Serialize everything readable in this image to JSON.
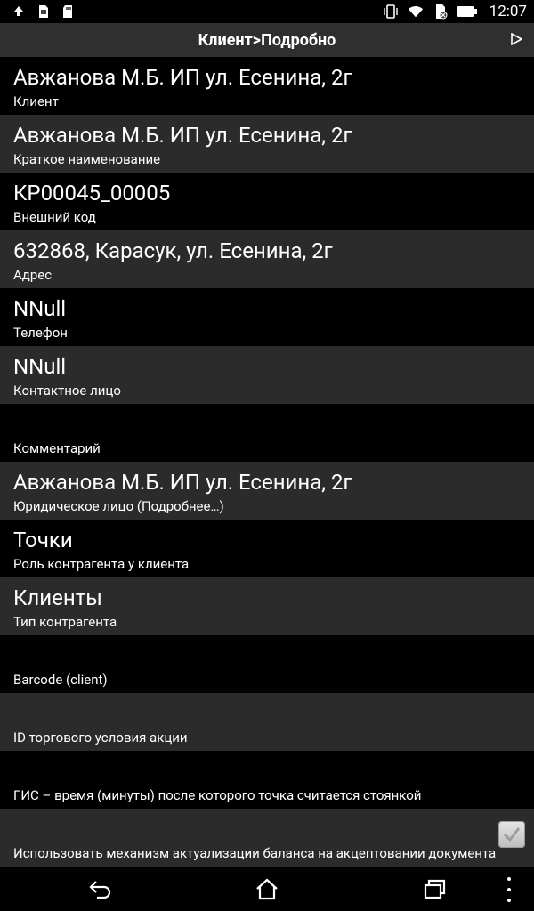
{
  "status_bar": {
    "time": "12:07",
    "left_icons": [
      "upload-icon",
      "file-icon",
      "sd-card-icon"
    ],
    "right_icons": [
      "vibrate-icon",
      "wifi-icon",
      "sim-icon",
      "battery-icon"
    ]
  },
  "header": {
    "title": "Клиент>Подробно",
    "forward_icon": "play-icon"
  },
  "rows": [
    {
      "value": "Авжанова М.Б. ИП ул. Есенина, 2г",
      "label": "Клиент"
    },
    {
      "value": "Авжанова М.Б. ИП ул. Есенина, 2г",
      "label": "Краткое наименование"
    },
    {
      "value": "КР00045_00005",
      "label": "Внешний код"
    },
    {
      "value": "632868, Карасук, ул. Есенина, 2г",
      "label": "Адрес"
    },
    {
      "value": "NNull",
      "label": "Телефон"
    },
    {
      "value": "NNull",
      "label": "Контактное лицо"
    },
    {
      "value": "",
      "label": "Комментарий"
    },
    {
      "value": "Авжанова М.Б. ИП ул. Есенина, 2г",
      "label": "Юридическое лицо (Подробнее…)"
    },
    {
      "value": "Точки",
      "label": "Роль контрагента у клиента"
    },
    {
      "value": "Клиенты",
      "label": "Тип контрагента"
    },
    {
      "value": "",
      "label": "Barcode (client)"
    },
    {
      "value": "",
      "label": "ID торгового условия акции"
    },
    {
      "value": "",
      "label": "ГИС – время (минуты) после которого точка считается  стоянкой"
    },
    {
      "value": "",
      "label": "Использовать механизм актуализации баланса на акцептовании документа",
      "checked": true
    }
  ],
  "nav": {
    "back_icon": "back-icon",
    "home_icon": "home-icon",
    "recents_icon": "recents-icon",
    "menu_icon": "overflow-menu-icon"
  }
}
